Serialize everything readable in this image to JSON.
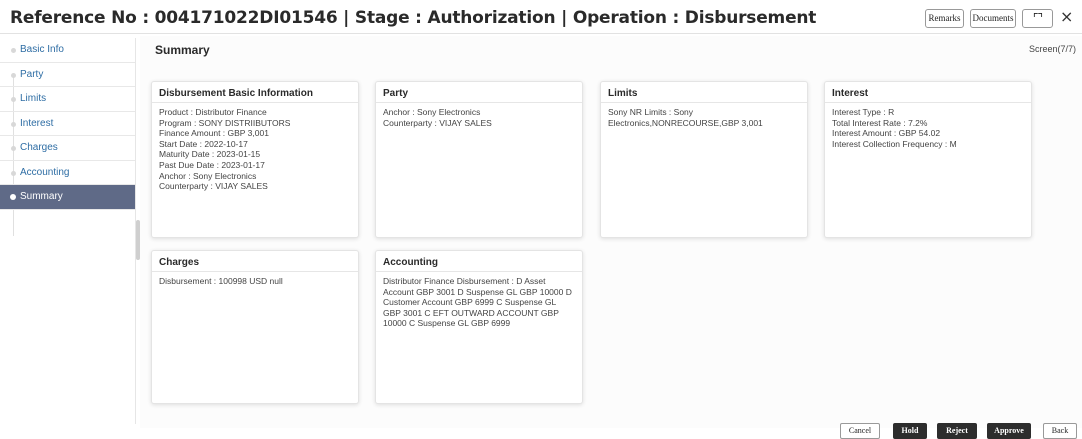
{
  "header": {
    "title": "Reference No : 004171022DI01546 | Stage : Authorization | Operation : Disbursement",
    "remarks_label": "Remarks",
    "documents_label": "Documents",
    "expand_glyph": "⌜⌝⌞⌟",
    "close_glyph": "×"
  },
  "sidebar": {
    "items": [
      {
        "label": "Basic Info"
      },
      {
        "label": "Party"
      },
      {
        "label": "Limits"
      },
      {
        "label": "Interest"
      },
      {
        "label": "Charges"
      },
      {
        "label": "Accounting"
      },
      {
        "label": "Summary"
      }
    ],
    "active_index": 6
  },
  "main": {
    "title": "Summary",
    "screen_indicator": "Screen(7/7)"
  },
  "cards": {
    "basic": {
      "title": "Disbursement Basic Information",
      "lines": [
        "Product : Distributor Finance",
        "Program : SONY DISTRIIBUTORS",
        "Finance Amount : GBP 3,001",
        "Start Date : 2022-10-17",
        "Maturity Date : 2023-01-15",
        "Past Due Date : 2023-01-17",
        "Anchor : Sony Electronics",
        "Counterparty : VIJAY SALES"
      ]
    },
    "party": {
      "title": "Party",
      "lines": [
        "Anchor : Sony Electronics",
        "Counterparty : VIJAY SALES"
      ]
    },
    "limits": {
      "title": "Limits",
      "text": "Sony NR Limits : Sony Electronics,NONRECOURSE,GBP 3,001"
    },
    "interest": {
      "title": "Interest",
      "lines": [
        "Interest Type : R",
        "Total Interest Rate : 7.2%",
        "Interest Amount : GBP 54.02",
        "Interest Collection Frequency : M"
      ]
    },
    "charges": {
      "title": "Charges",
      "lines": [
        "Disbursement : 100998 USD null"
      ]
    },
    "accounting": {
      "title": "Accounting",
      "text": "Distributor Finance Disbursement : D Asset Account GBP 3001 D Suspense GL GBP 10000 D Customer Account GBP 6999 C Suspense GL GBP 3001 C EFT OUTWARD ACCOUNT GBP 10000 C Suspense GL GBP 6999"
    }
  },
  "footer": {
    "cancel_label": "Cancel",
    "hold_label": "Hold",
    "reject_label": "Reject",
    "approve_label": "Approve",
    "back_label": "Back"
  }
}
